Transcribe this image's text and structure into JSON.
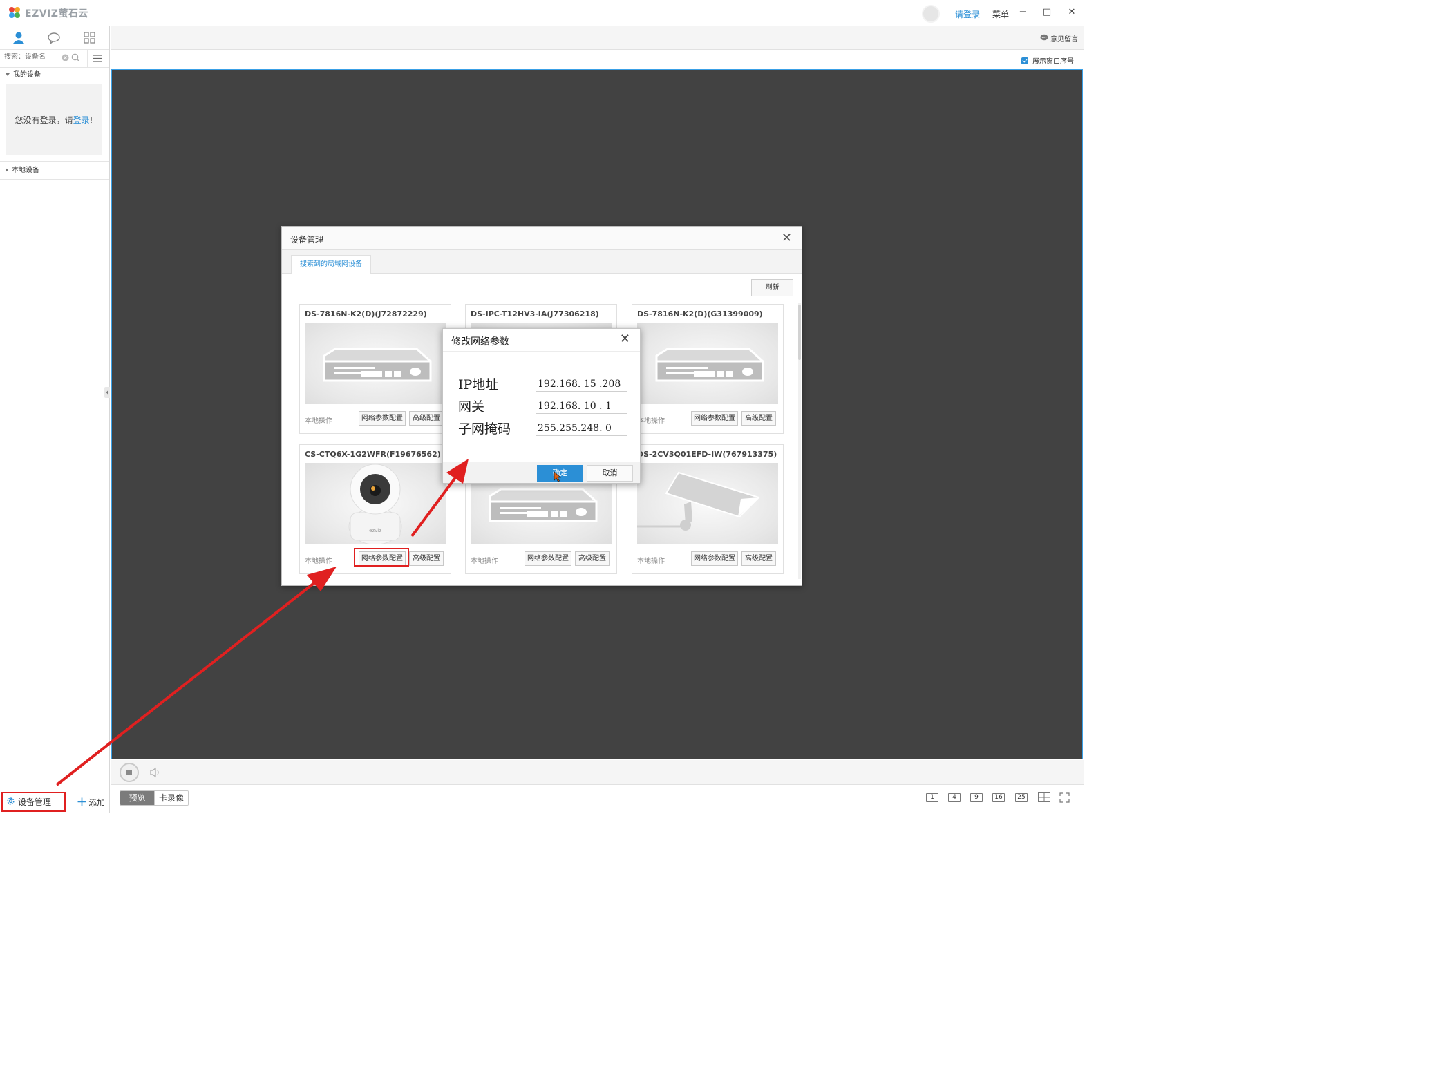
{
  "app": {
    "brand": "EZVIZ萤石云"
  },
  "titlebar": {
    "login_label": "请登录",
    "menu_label": "菜单",
    "minimize": "−",
    "maximize": "□",
    "close": "✕"
  },
  "sidebar": {
    "search_placeholder": "搜索：设备名",
    "my_devices": "我的设备",
    "login_prompt_prefix": "您没有登录，请",
    "login_link": "登录",
    "login_prompt_suffix": "!",
    "local_devices": "本地设备",
    "device_mgmt": "设备管理",
    "add": "添加"
  },
  "main": {
    "feedback": "意见留言",
    "show_window_index": "展示窗口序号",
    "tabs": [
      "预览",
      "卡录像"
    ],
    "layouts": [
      "1",
      "4",
      "9",
      "16",
      "25"
    ]
  },
  "device_dialog": {
    "title": "设备管理",
    "tab": "搜索到的局域网设备",
    "refresh": "刷新",
    "local_op": "本地操作",
    "net_btn": "网络参数配置",
    "adv_btn": "高级配置",
    "devices": [
      {
        "name": "DS-7816N-K2(D)(J72872229)",
        "kind": "nvr"
      },
      {
        "name": "DS-IPC-T12HV3-IA(J77306218)",
        "kind": "nvr"
      },
      {
        "name": "DS-7816N-K2(D)(G31399009)",
        "kind": "nvr"
      },
      {
        "name": "CS-CTQ6X-1G2WFR(F19676562)",
        "kind": "ptz"
      },
      {
        "name": "",
        "kind": "nvr"
      },
      {
        "name": "DS-2CV3Q01EFD-IW(767913375)",
        "kind": "bullet"
      }
    ]
  },
  "net_dialog": {
    "title": "修改网络参数",
    "ip_label": "IP地址",
    "ip_value": "192.168. 15 .208",
    "gateway_label": "网关",
    "gateway_value": "192.168. 10 .  1",
    "mask_label": "子网掩码",
    "mask_value": "255.255.248.  0",
    "ok": "确定",
    "cancel": "取消"
  },
  "colors": {
    "accent": "#2b8fd6",
    "annotation": "#e02020",
    "video_bg": "#424242"
  }
}
